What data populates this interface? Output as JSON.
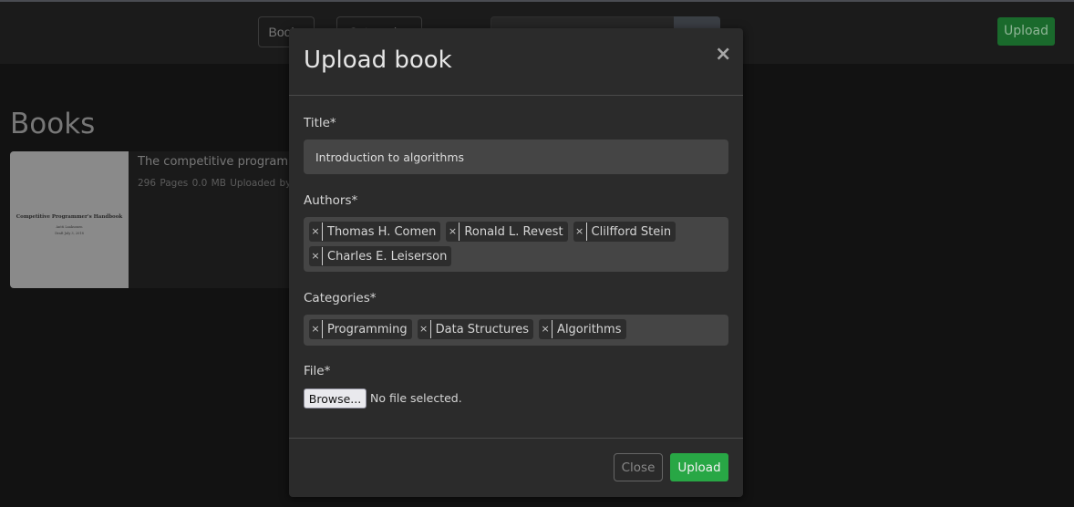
{
  "navbar": {
    "books_label": "Books",
    "categories_label": "Categories",
    "search_placeholder": "",
    "search_button_label": "",
    "upload_label": "Upload"
  },
  "page": {
    "title": "Books",
    "books": [
      {
        "title": "The competitive programmer's handbook",
        "meta": "296 Pages  0.0 MB  Uploaded by:",
        "cover": {
          "title": "Competitive Programmer's Handbook",
          "author": "Antti Laaksonen",
          "date": "Draft July 3, 2018"
        }
      }
    ]
  },
  "modal": {
    "title": "Upload book",
    "close_icon": "times-icon",
    "title_label": "Title*",
    "title_value": "Introduction to algorithms",
    "authors_label": "Authors*",
    "authors": [
      "Thomas H. Comen",
      "Ronald L. Revest",
      "Clilfford Stein",
      "Charles E. Leiserson"
    ],
    "categories_label": "Categories*",
    "categories": [
      "Programming",
      "Data Structures",
      "Algorithms"
    ],
    "file_label": "File*",
    "browse_label": "Browse...",
    "file_status": "No file selected.",
    "close_button_label": "Close",
    "upload_button_label": "Upload",
    "tag_remove_glyph": "×"
  },
  "colors": {
    "accent_green": "#28a745",
    "background": "#121212",
    "modal_bg": "#2b2b2b"
  }
}
